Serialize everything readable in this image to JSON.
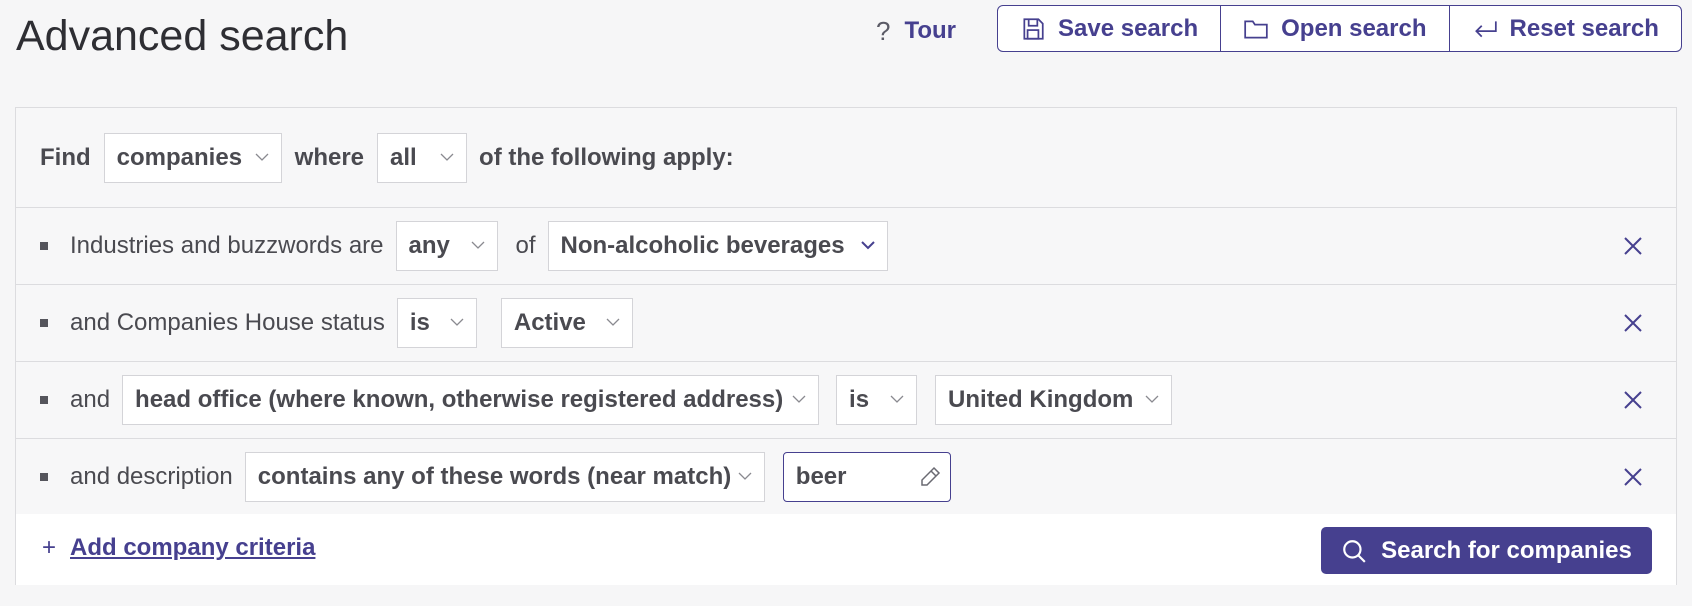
{
  "header": {
    "title": "Advanced search",
    "tour_label": "Tour",
    "save_label": "Save search",
    "open_label": "Open search",
    "reset_label": "Reset search"
  },
  "find_row": {
    "find_label": "Find",
    "entity_value": "companies",
    "where_label": "where",
    "match_value": "all",
    "suffix_label": "of the following apply:"
  },
  "criteria": [
    {
      "label": "Industries and buzzwords are",
      "operator": "any",
      "connector": "of",
      "value": "Non-alcoholic beverages"
    },
    {
      "label": "and Companies House status",
      "operator": "is",
      "value": "Active"
    },
    {
      "label": "and",
      "field": "head office (where known, otherwise registered address)",
      "operator": "is",
      "value": "United Kingdom"
    },
    {
      "label": "and description",
      "operator": "contains any of these words (near match)",
      "value": "beer"
    }
  ],
  "footer": {
    "add_label": "Add company criteria",
    "search_label": "Search for companies"
  },
  "colors": {
    "accent": "#46408f",
    "background": "#f6f6f7"
  }
}
